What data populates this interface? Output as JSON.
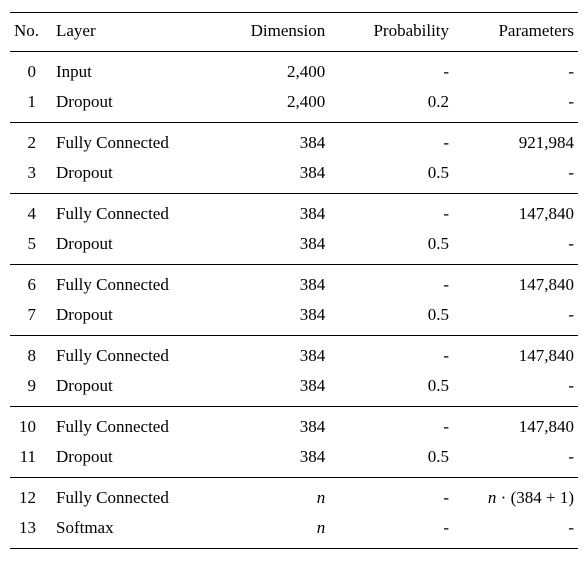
{
  "headers": {
    "no": "No.",
    "layer": "Layer",
    "dimension": "Dimension",
    "probability": "Probability",
    "parameters": "Parameters"
  },
  "groups": [
    [
      {
        "no": "0",
        "layer": "Input",
        "dimension": "2,400",
        "probability": "-",
        "parameters": "-"
      },
      {
        "no": "1",
        "layer": "Dropout",
        "dimension": "2,400",
        "probability": "0.2",
        "parameters": "-"
      }
    ],
    [
      {
        "no": "2",
        "layer": "Fully Connected",
        "dimension": "384",
        "probability": "-",
        "parameters": "921,984"
      },
      {
        "no": "3",
        "layer": "Dropout",
        "dimension": "384",
        "probability": "0.5",
        "parameters": "-"
      }
    ],
    [
      {
        "no": "4",
        "layer": "Fully Connected",
        "dimension": "384",
        "probability": "-",
        "parameters": "147,840"
      },
      {
        "no": "5",
        "layer": "Dropout",
        "dimension": "384",
        "probability": "0.5",
        "parameters": "-"
      }
    ],
    [
      {
        "no": "6",
        "layer": "Fully Connected",
        "dimension": "384",
        "probability": "-",
        "parameters": "147,840"
      },
      {
        "no": "7",
        "layer": "Dropout",
        "dimension": "384",
        "probability": "0.5",
        "parameters": "-"
      }
    ],
    [
      {
        "no": "8",
        "layer": "Fully Connected",
        "dimension": "384",
        "probability": "-",
        "parameters": "147,840"
      },
      {
        "no": "9",
        "layer": "Dropout",
        "dimension": "384",
        "probability": "0.5",
        "parameters": "-"
      }
    ],
    [
      {
        "no": "10",
        "layer": "Fully Connected",
        "dimension": "384",
        "probability": "-",
        "parameters": "147,840"
      },
      {
        "no": "11",
        "layer": "Dropout",
        "dimension": "384",
        "probability": "0.5",
        "parameters": "-"
      }
    ],
    [
      {
        "no": "12",
        "layer": "Fully Connected",
        "dimension": "n",
        "probability": "-",
        "parameters": "n · (384 + 1)",
        "dim_italic": true
      },
      {
        "no": "13",
        "layer": "Softmax",
        "dimension": "n",
        "probability": "-",
        "parameters": "-",
        "dim_italic": true
      }
    ]
  ],
  "chart_data": {
    "type": "table",
    "title": "Neural network layer configuration",
    "columns": [
      "No.",
      "Layer",
      "Dimension",
      "Probability",
      "Parameters"
    ],
    "rows": [
      [
        0,
        "Input",
        "2,400",
        "-",
        "-"
      ],
      [
        1,
        "Dropout",
        "2,400",
        "0.2",
        "-"
      ],
      [
        2,
        "Fully Connected",
        "384",
        "-",
        "921,984"
      ],
      [
        3,
        "Dropout",
        "384",
        "0.5",
        "-"
      ],
      [
        4,
        "Fully Connected",
        "384",
        "-",
        "147,840"
      ],
      [
        5,
        "Dropout",
        "384",
        "0.5",
        "-"
      ],
      [
        6,
        "Fully Connected",
        "384",
        "-",
        "147,840"
      ],
      [
        7,
        "Dropout",
        "384",
        "0.5",
        "-"
      ],
      [
        8,
        "Fully Connected",
        "384",
        "-",
        "147,840"
      ],
      [
        9,
        "Dropout",
        "384",
        "0.5",
        "-"
      ],
      [
        10,
        "Fully Connected",
        "384",
        "-",
        "147,840"
      ],
      [
        11,
        "Dropout",
        "384",
        "0.5",
        "-"
      ],
      [
        12,
        "Fully Connected",
        "n",
        "-",
        "n · (384 + 1)"
      ],
      [
        13,
        "Softmax",
        "n",
        "-",
        "-"
      ]
    ]
  }
}
